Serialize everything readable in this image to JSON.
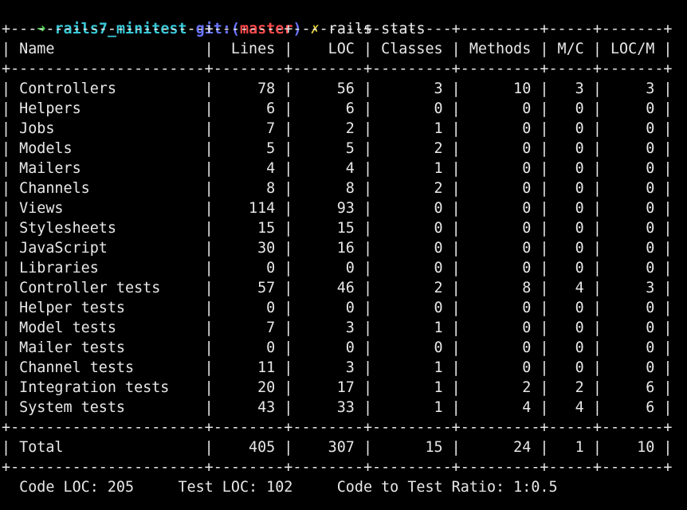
{
  "prompt": {
    "arrow": "➜",
    "directory": "rails7_minitest",
    "git_label": "git:(",
    "branch": "master",
    "git_close": ")",
    "dirty_marker": "✗",
    "command": "rails stats"
  },
  "colors": {
    "background": "#000000",
    "text": "#e8e8e8",
    "arrow": "#4fd14f",
    "directory": "#39c9d8",
    "git": "#6a74ff",
    "branch": "#ff4a4a",
    "dirty": "#e6d43a"
  },
  "stats": {
    "separator": "+----------------------+--------+--------+---------+---------+-----+-------+",
    "headers": [
      "Name",
      "Lines",
      "LOC",
      "Classes",
      "Methods",
      "M/C",
      "LOC/M"
    ],
    "rows": [
      [
        "Controllers",
        "78",
        "56",
        "3",
        "10",
        "3",
        "3"
      ],
      [
        "Helpers",
        "6",
        "6",
        "0",
        "0",
        "0",
        "0"
      ],
      [
        "Jobs",
        "7",
        "2",
        "1",
        "0",
        "0",
        "0"
      ],
      [
        "Models",
        "5",
        "5",
        "2",
        "0",
        "0",
        "0"
      ],
      [
        "Mailers",
        "4",
        "4",
        "1",
        "0",
        "0",
        "0"
      ],
      [
        "Channels",
        "8",
        "8",
        "2",
        "0",
        "0",
        "0"
      ],
      [
        "Views",
        "114",
        "93",
        "0",
        "0",
        "0",
        "0"
      ],
      [
        "Stylesheets",
        "15",
        "15",
        "0",
        "0",
        "0",
        "0"
      ],
      [
        "JavaScript",
        "30",
        "16",
        "0",
        "0",
        "0",
        "0"
      ],
      [
        "Libraries",
        "0",
        "0",
        "0",
        "0",
        "0",
        "0"
      ],
      [
        "Controller tests",
        "57",
        "46",
        "2",
        "8",
        "4",
        "3"
      ],
      [
        "Helper tests",
        "0",
        "0",
        "0",
        "0",
        "0",
        "0"
      ],
      [
        "Model tests",
        "7",
        "3",
        "1",
        "0",
        "0",
        "0"
      ],
      [
        "Mailer tests",
        "0",
        "0",
        "0",
        "0",
        "0",
        "0"
      ],
      [
        "Channel tests",
        "11",
        "3",
        "1",
        "0",
        "0",
        "0"
      ],
      [
        "Integration tests",
        "20",
        "17",
        "1",
        "2",
        "2",
        "6"
      ],
      [
        "System tests",
        "43",
        "33",
        "1",
        "4",
        "4",
        "6"
      ]
    ],
    "total": [
      "Total",
      "405",
      "307",
      "15",
      "24",
      "1",
      "10"
    ],
    "summary": "  Code LOC: 205     Test LOC: 102     Code to Test Ratio: 1:0.5"
  }
}
